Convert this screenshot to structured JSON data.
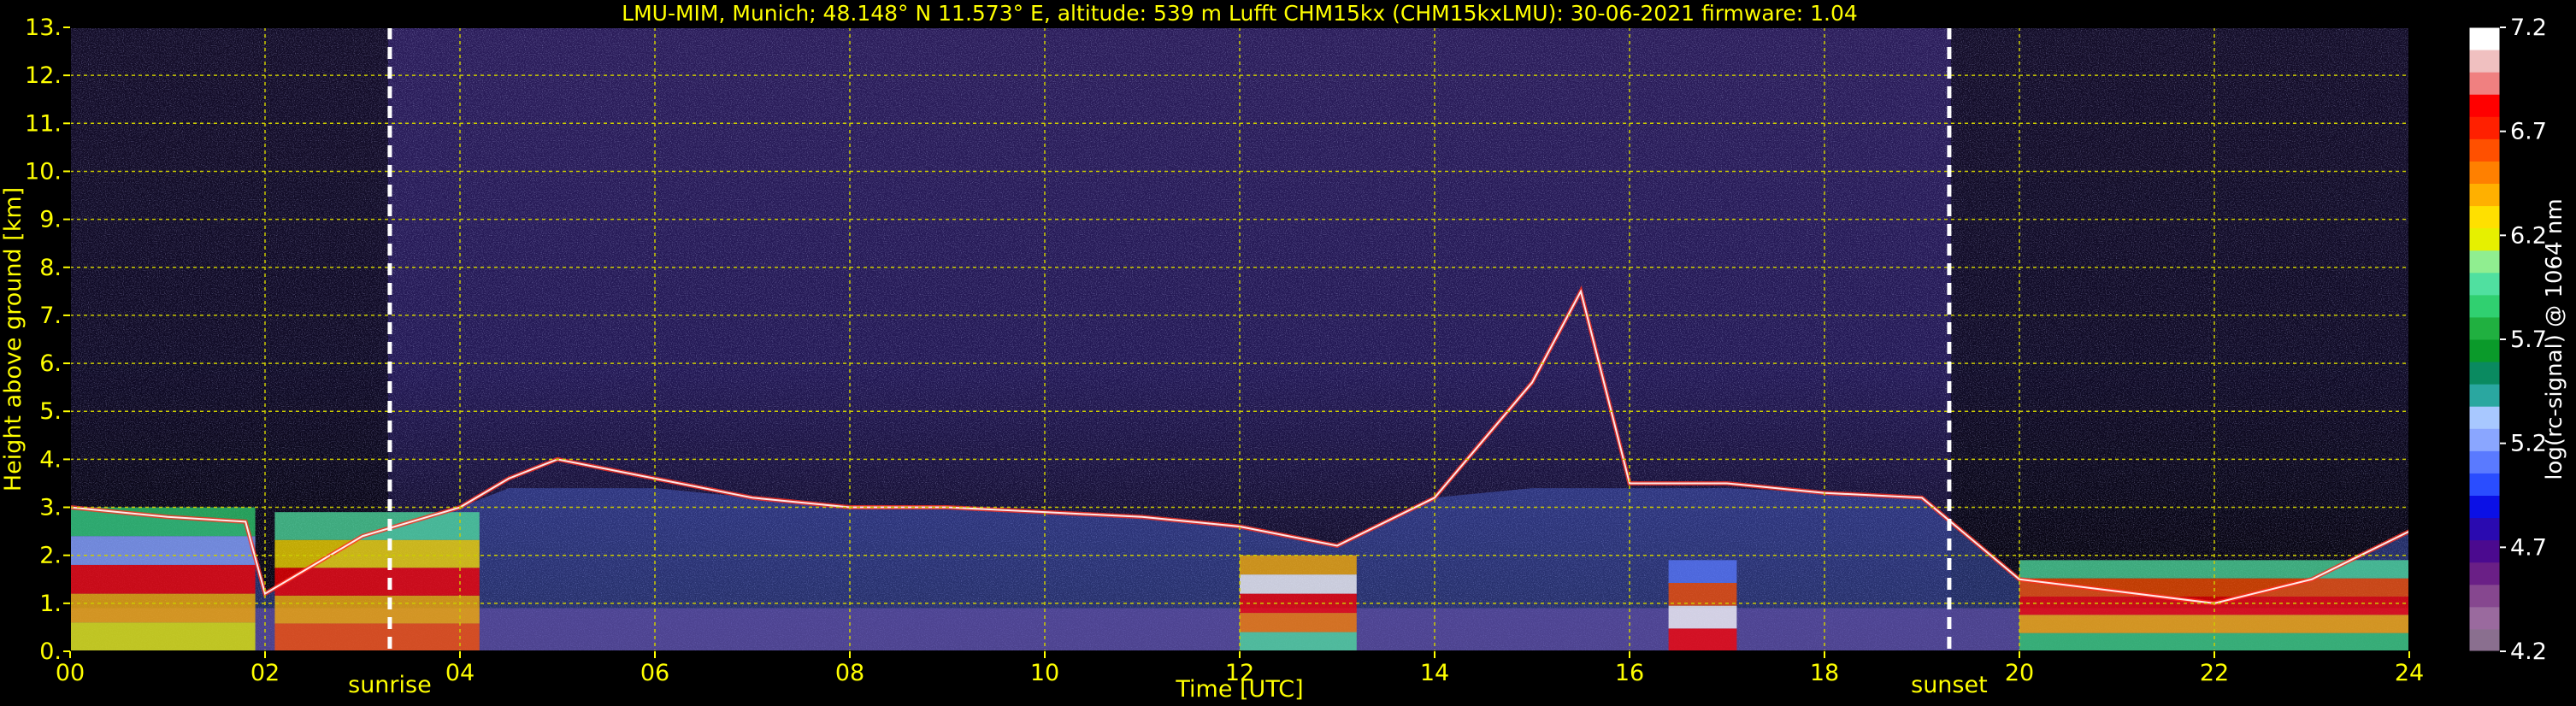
{
  "chart_data": {
    "type": "heatmap",
    "title": "LMU-MIM, Munich; 48.148° N 11.573° E, altitude: 539 m    Lufft CHM15kx (CHM15kxLMU): 30-06-2021    firmware: 1.04",
    "xlabel": "Time [UTC]",
    "ylabel": "Height above ground [km]",
    "colorbar_label": "log(rc-signal) @ 1064 nm",
    "xlim": [
      0,
      24
    ],
    "ylim": [
      0,
      13
    ],
    "x_ticks": [
      "00",
      "02",
      "04",
      "06",
      "08",
      "10",
      "12",
      "14",
      "16",
      "18",
      "20",
      "22",
      "24"
    ],
    "y_ticks": [
      "0.",
      "1.",
      "2.",
      "3.",
      "4.",
      "5.",
      "6.",
      "7.",
      "8.",
      "9.",
      "10.",
      "11.",
      "12.",
      "13."
    ],
    "colorbar_ticks": [
      "4.2",
      "4.7",
      "5.2",
      "5.7",
      "6.2",
      "6.7",
      "7.2"
    ],
    "colorbar_range": [
      4.2,
      7.2
    ],
    "grid": true,
    "colors": {
      "background": "#000000",
      "text": "#ffff00",
      "grid": "#cccc00",
      "marker": "#ffffff"
    },
    "colormap": [
      "#8a6f8f",
      "#9a6a9e",
      "#86478f",
      "#6a1f86",
      "#4b0a8f",
      "#2a0ab0",
      "#0b10e6",
      "#2a4dff",
      "#5a7aff",
      "#8aa6ff",
      "#a8c8ff",
      "#2aa7a0",
      "#0a8a60",
      "#0a9a2a",
      "#20b040",
      "#30d070",
      "#50e0a0",
      "#90ee90",
      "#e6f000",
      "#ffe000",
      "#ffb000",
      "#ff8000",
      "#ff5000",
      "#ff2000",
      "#ff0000",
      "#f08080",
      "#f0c0c0",
      "#ffffff"
    ],
    "events": [
      {
        "label": "sunrise",
        "time": 3.28
      },
      {
        "label": "sunset",
        "time": 19.28
      }
    ],
    "layers": [
      {
        "name": "boundary layer (approx.)",
        "points": [
          [
            0,
            3.0
          ],
          [
            1,
            2.8
          ],
          [
            1.8,
            2.7
          ],
          [
            2,
            1.2
          ],
          [
            3,
            2.4
          ],
          [
            4,
            3.0
          ],
          [
            4.5,
            3.6
          ],
          [
            5,
            4.0
          ],
          [
            6,
            3.6
          ],
          [
            7,
            3.2
          ],
          [
            8,
            3.0
          ],
          [
            9,
            3.0
          ],
          [
            10,
            2.9
          ],
          [
            11,
            2.8
          ],
          [
            12,
            2.6
          ],
          [
            13,
            2.2
          ],
          [
            14,
            3.2
          ],
          [
            15,
            5.6
          ],
          [
            15.5,
            7.5
          ],
          [
            16,
            3.5
          ],
          [
            17,
            3.5
          ],
          [
            18,
            3.3
          ],
          [
            19,
            3.2
          ],
          [
            20,
            1.5
          ],
          [
            22,
            1.0
          ],
          [
            23,
            1.5
          ],
          [
            24,
            2.5
          ]
        ]
      }
    ]
  }
}
